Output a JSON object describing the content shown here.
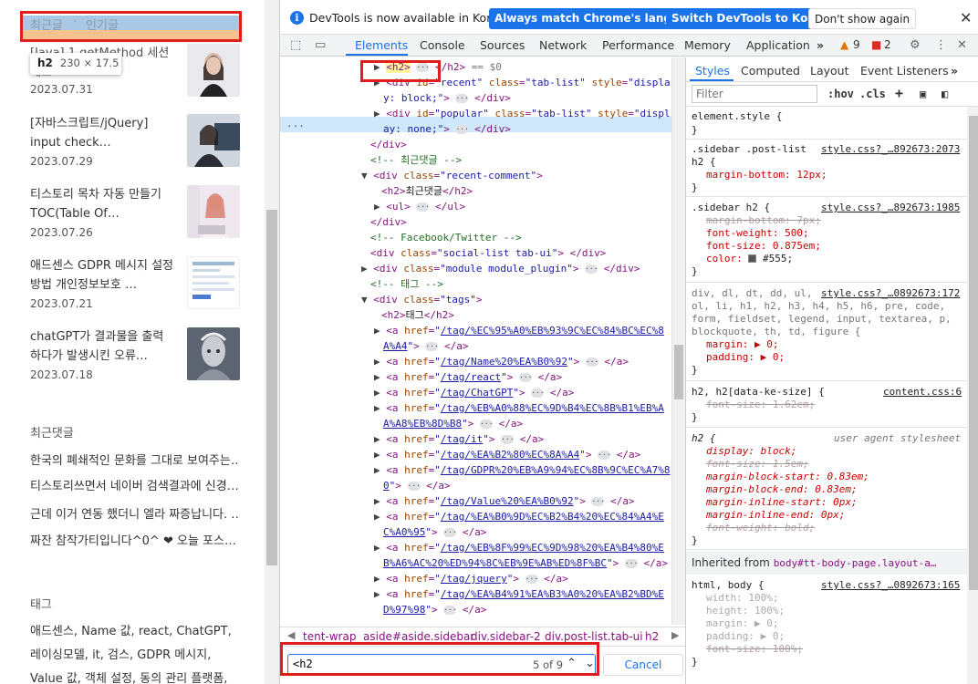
{
  "blog": {
    "tabs": {
      "recent": "최근글",
      "popular": "인기글"
    },
    "tooltip": {
      "tag": "h2",
      "size": "230 × 17.5"
    },
    "posts": [
      {
        "title": "[Java] 1.getMethod 세션 메소",
        "date": "2023.07.31"
      },
      {
        "title": "[자바스크립트/jQuery] input check…",
        "date": "2023.07.29"
      },
      {
        "title": "티스토리 목차 자동 만들기 TOC(Table Of…",
        "date": "2023.07.26"
      },
      {
        "title": "애드센스 GDPR 메시지 설정 방법 개인정보보호 …",
        "date": "2023.07.21"
      },
      {
        "title": "chatGPT가 결과물을 출력 하다가 발생시킨 오류…",
        "date": "2023.07.18"
      }
    ],
    "comments_title": "최근댓글",
    "comments": [
      "한국의 폐쇄적인 문화를 그대로 보여주는…",
      "티스토리쓰면서 네이버 검색결과에 신경…",
      "근데 이거 연동 했더니 엘라 짜증납니다. …",
      "짜잔 참작가티입니다^0^ ❤ 오늘 포스…"
    ],
    "tags_title": "태그",
    "tags_text": "애드센스, Name 값, react, ChatGPT, 레이싱모델, it, 검스, GDPR 메시지, Value 값, 객체 설정, 동의 관리 플랫폼,"
  },
  "devtools": {
    "infobar": {
      "message": "DevTools is now available in Korean!",
      "btn_match": "Always match Chrome's language",
      "btn_switch": "Switch DevTools to Korean",
      "btn_dismiss": "Don't show again"
    },
    "tabs": [
      "Elements",
      "Console",
      "Sources",
      "Network",
      "Performance",
      "Memory",
      "Application"
    ],
    "warnings": "9",
    "errors": "2",
    "breadcrumbs": [
      "tent-wrap",
      "aside#aside.sidebar",
      "div.sidebar-2",
      "div.post-list.tab-ui",
      "h2"
    ],
    "search": {
      "value": "<h2",
      "count": "5 of 9",
      "cancel": "Cancel"
    },
    "styles_tabs": [
      "Styles",
      "Computed",
      "Layout",
      "Event Listeners"
    ],
    "filter_placeholder": "Filter",
    "hov": ":hov",
    "cls": ".cls",
    "inherited_label": "Inherited from",
    "inherited_from": "body#tt-body-page.layout-a…",
    "tree": {
      "h2_selected": "== $0",
      "comment_recent": "<!-- 최근댓글 -->",
      "h2_recent_comment": "최근댓글",
      "comment_fb": "<!-- Facebook/Twitter -->",
      "comment_tag": "<!-- 태그 -->",
      "h2_tags": "태그",
      "links": [
        "/tag/%EC%95%A0%EB%93%9C%EC%84%BC%EC%8",
        "A%A4",
        "/tag/Name%20%EA%B0%92",
        "/tag/react",
        "/tag/ChatGPT",
        "/tag/%EB%A0%88%EC%9D%B4%EC%8B%B1%EB%A",
        "A%A8%EB%8D%B8",
        "/tag/it",
        "/tag/%EA%B2%80%EC%8A%A4",
        "/tag/GDPR%20%EB%A9%94%EC%8B%9C%EC%A7%8",
        "0",
        "/tag/Value%20%EA%B0%92",
        "/tag/%EA%B0%9D%EC%B2%B4%20%EC%84%A4%E",
        "C%A0%95",
        "/tag/%EB%8F%99%EC%9D%98%20%EA%B4%80%E",
        "B%A6%AC%20%ED%94%8C%EB%9E%AB%ED%8F%BC",
        "/tag/jquery",
        "/tag/%EA%B4%91%EA%B3%A0%20%EA%B2%BD%E",
        "D%97%98"
      ]
    },
    "rules": {
      "element_style": "element.style {",
      "r1_sel1": ".sidebar .post-list",
      "r1_sel2": "h2 {",
      "r1_src": "style.css?_…892673:2073",
      "r1_p1": "margin-bottom: 12px;",
      "r2_sel": ".sidebar h2 {",
      "r2_src": "style.css?_…892673:1985",
      "r2_p1": "margin-bottom: 7px;",
      "r2_p2": "font-weight: 500;",
      "r2_p3": "font-size: 0.875em;",
      "r2_p4": "color: ",
      "r2_p4v": "#555;",
      "r3_sel1": "div, dl, dt, dd, ul,",
      "r3_src": "style.css?_…0892673:172",
      "r3_sel2": "ol, li, h1, h2, h3, h4, h5, h6, pre, code,",
      "r3_sel3": "form, fieldset, legend, input, textarea, p,",
      "r3_sel4": "blockquote, th, td, figure {",
      "r3_p1": "margin: ▶ 0;",
      "r3_p2": "padding: ▶ 0;",
      "r4_sel": "h2, h2[data-ke-size] {",
      "r4_src": "content.css:6",
      "r4_p1": "font-size: 1.62em;",
      "r5_sel": "h2 {",
      "r5_src": "user agent stylesheet",
      "r5_props": [
        "display: block;",
        "font-size: 1.5em;",
        "margin-block-start: 0.83em;",
        "margin-block-end: 0.83em;",
        "margin-inline-start: 0px;",
        "margin-inline-end: 0px;",
        "font-weight: bold;"
      ],
      "r6_sel": "html, body {",
      "r6_src": "style.css?_…0892673:165",
      "r6_props": [
        "width: 100%;",
        "height: 100%;",
        "margin: ▶ 0;",
        "padding: ▶ 0;",
        "font-size: 100%;"
      ]
    }
  }
}
